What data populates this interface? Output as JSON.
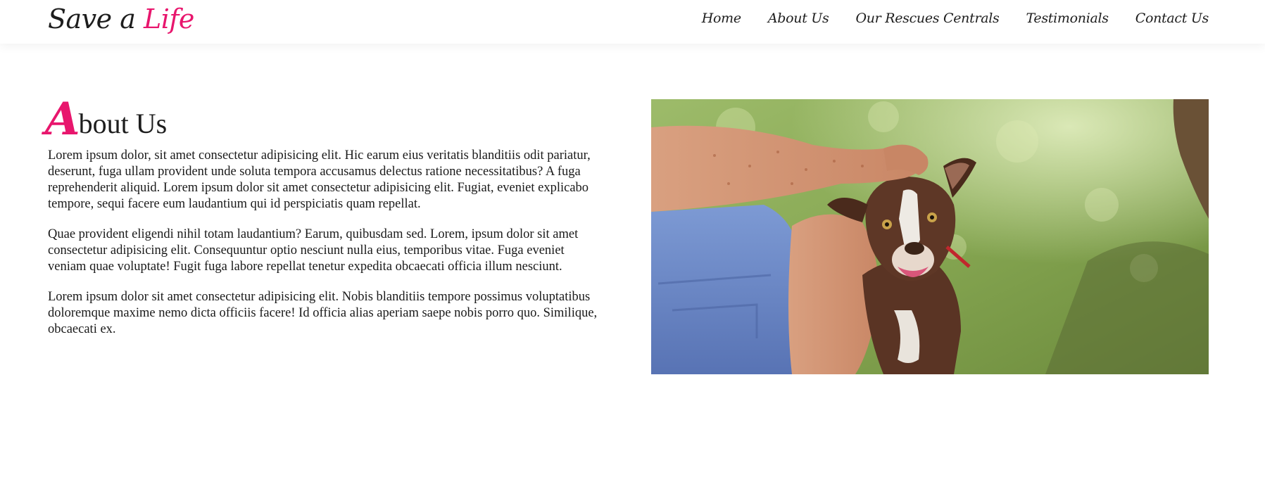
{
  "header": {
    "logo_main": "Save a ",
    "logo_accent": "Life",
    "nav": [
      {
        "label": "Home"
      },
      {
        "label": "About Us"
      },
      {
        "label": "Our Rescues Centrals"
      },
      {
        "label": "Testimonials"
      },
      {
        "label": "Contact Us"
      }
    ]
  },
  "about": {
    "heading_initial": "A",
    "heading_rest": "bout Us",
    "paragraphs": [
      "Lorem ipsum dolor, sit amet consectetur adipisicing elit. Hic earum eius veritatis blanditiis odit pariatur, deserunt, fuga ullam provident unde soluta tempora accusamus delectus ratione necessitatibus? A fuga reprehenderit aliquid. Lorem ipsum dolor sit amet consectetur adipisicing elit. Fugiat, eveniet explicabo tempore, sequi facere eum laudantium qui id perspiciatis quam repellat.",
      "Quae provident eligendi nihil totam laudantium? Earum, quibusdam sed. Lorem, ipsum dolor sit amet consectetur adipisicing elit. Consequuntur optio nesciunt nulla eius, temporibus vitae. Fuga eveniet veniam quae voluptate! Fugit fuga labore repellat tenetur expedita obcaecati officia illum nesciunt.",
      "Lorem ipsum dolor sit amet consectetur adipisicing elit. Nobis blanditiis tempore possimus voluptatibus doloremque maxime nemo dicta officiis facere! Id officia alias aperiam saepe nobis porro quo. Similique, obcaecati ex."
    ]
  },
  "photo": {
    "subject": "person-petting-dog-photo"
  },
  "colors": {
    "accent": "#e8166d",
    "text": "#1d1d1d",
    "background": "#ffffff"
  }
}
